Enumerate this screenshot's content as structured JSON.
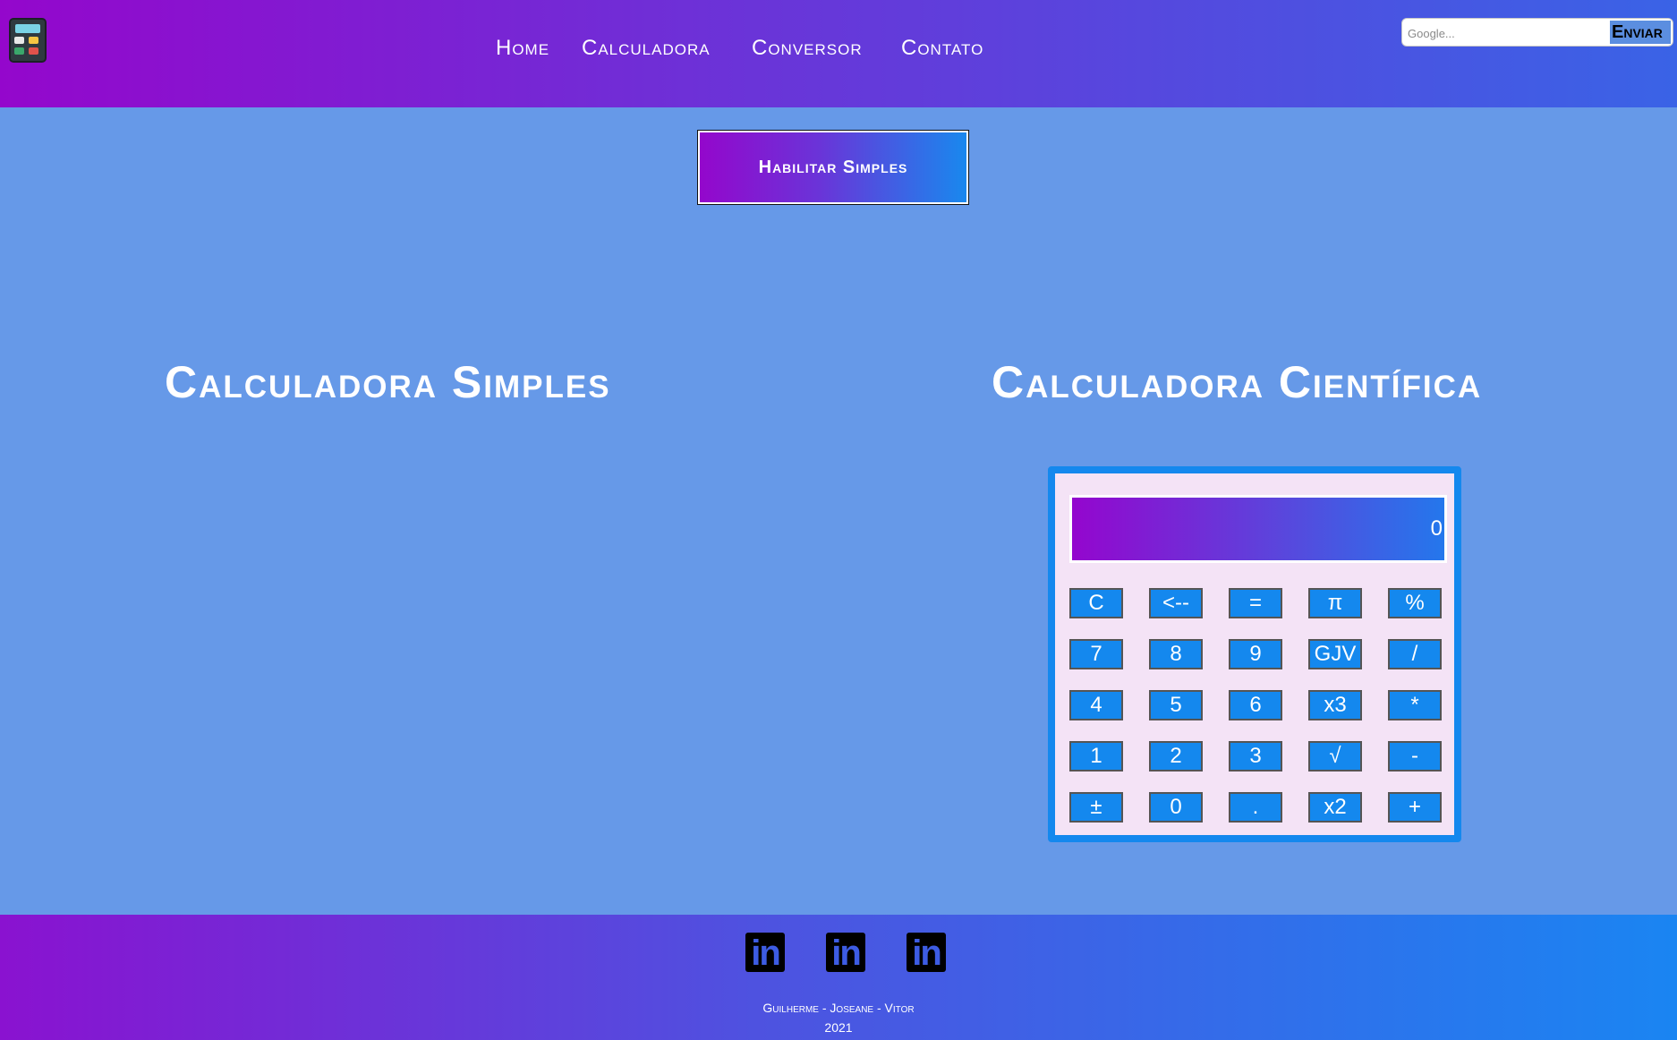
{
  "header": {
    "logo_icon": "calculator-icon",
    "nav": [
      "Home",
      "Calculadora",
      "Conversor",
      "Contato"
    ],
    "search": {
      "placeholder": "Google...",
      "button_label": "Enviar"
    }
  },
  "toggle_button_label": "Habilitar Simples",
  "sections": {
    "simple_title": "Calculadora Simples",
    "scientific_title": "Calculadora Científica"
  },
  "calculator": {
    "display_value": "0",
    "keys": [
      [
        "C",
        "<--",
        "=",
        "π",
        "%"
      ],
      [
        "7",
        "8",
        "9",
        "GJV",
        "/"
      ],
      [
        "4",
        "5",
        "6",
        "x3",
        "*"
      ],
      [
        "1",
        "2",
        "3",
        "√",
        "-"
      ],
      [
        "±",
        "0",
        ".",
        "x2",
        "+"
      ]
    ]
  },
  "footer": {
    "social_icons": [
      "linkedin-icon",
      "linkedin-icon",
      "linkedin-icon"
    ],
    "social_glyph": "in",
    "names": "Guilherme - Joseane - Vitor",
    "year": "2021"
  },
  "colors": {
    "page_bg": "#6699e8",
    "gradient_start": "#9407cc",
    "gradient_end": "#1988ee",
    "key_bg": "#1488ee",
    "calc_bg": "#f4e3f6"
  }
}
